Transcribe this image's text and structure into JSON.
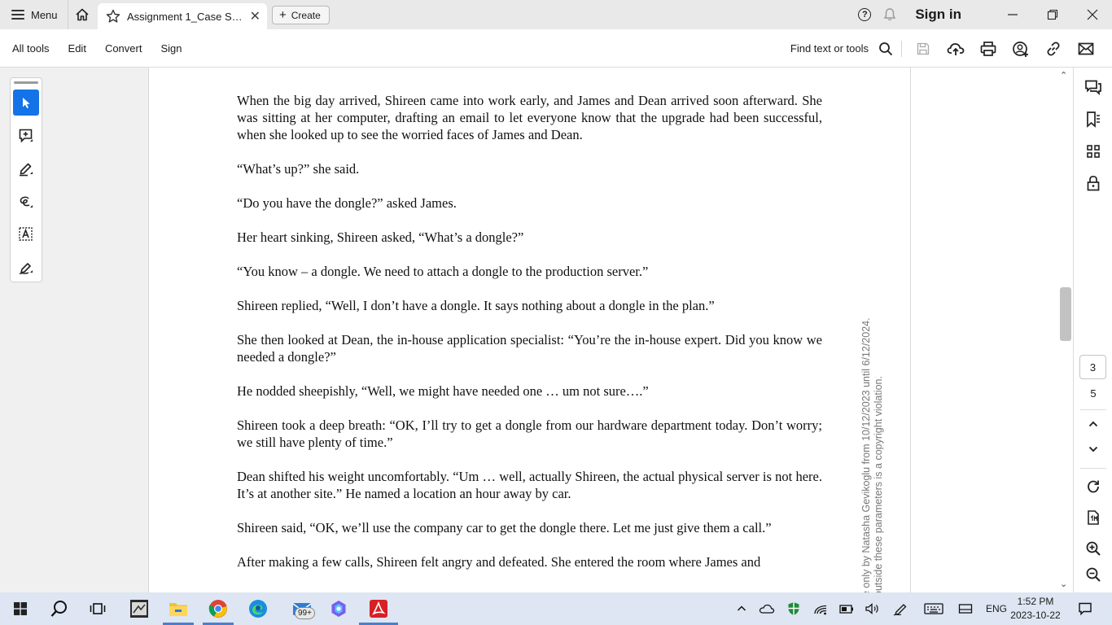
{
  "titlebar": {
    "menu_label": "Menu",
    "tab_title": "Assignment 1_Case Stud...",
    "create_label": "Create",
    "signin_label": "Sign in"
  },
  "toolbar": {
    "menus": [
      "All tools",
      "Edit",
      "Convert",
      "Sign"
    ],
    "find_label": "Find text or tools"
  },
  "left_tools": [
    "select-cursor-icon",
    "add-comment-icon",
    "highlight-pen-icon",
    "freehand-draw-icon",
    "text-recognition-icon",
    "sign-pen-icon"
  ],
  "document": {
    "paragraphs": [
      "When the big day arrived, Shireen came into work early, and James and Dean arrived soon afterward. She was sitting at her computer, drafting an email to let everyone know that the upgrade had been successful, when she looked up to see the worried faces of James and Dean.",
      "“What’s up?” she said.",
      "“Do you have the dongle?” asked James.",
      "Her heart sinking, Shireen asked, “What’s a dongle?”",
      "“You know – a dongle. We need to attach a dongle to the production server.”",
      "Shireen replied, “Well, I don’t have a dongle. It says nothing about a dongle in the plan.”",
      "She then looked at Dean, the in-house application specialist: “You’re the in-house expert. Did you know we needed a dongle?”",
      "He nodded sheepishly, “Well, we might have needed one … um not sure….”",
      "Shireen took a deep breath: “OK, I’ll try to get a dongle from our hardware department today. Don’t worry; we still have plenty of time.”",
      "Dean shifted his weight uncomfortably. “Um … well, actually Shireen, the actual physical server is not here. It’s at another site.” He named a location an hour away by car.",
      "Shireen said, “OK, we’ll use the company car to get the dongle there. Let me just give them a call.”",
      "After making a few calls, Shireen felt angry and defeated. She entered the room where James and"
    ],
    "watermark_line1": "e only by Natasha Gevikoglu from 10/12/2023 until 6/12/2024.",
    "watermark_line2": "outside these parameters is a copyright violation."
  },
  "pagination": {
    "current_page": "3",
    "total_pages": "5"
  },
  "taskbar": {
    "mail_badge": "99+",
    "language": "ENG",
    "time": "1:52 PM",
    "date": "2023-10-22"
  },
  "colors": {
    "accent": "#1473e6",
    "acrobat_red": "#d81f26",
    "taskbar_bg": "#dde6f2"
  }
}
